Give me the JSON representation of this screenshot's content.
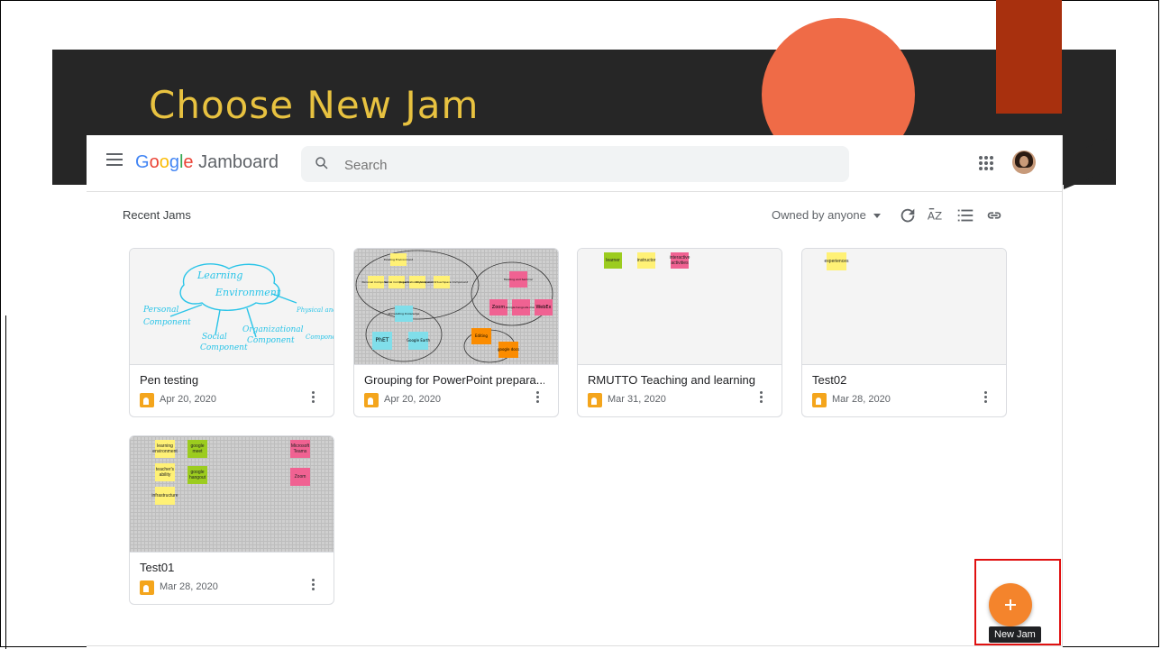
{
  "slide": {
    "title": "Choose New Jam",
    "colors": {
      "band": "#262626",
      "title": "#e8c240",
      "circle": "#ef6b47",
      "accent_rect": "#a8300e"
    }
  },
  "app": {
    "brand_google": "Google",
    "brand_product": "Jamboard",
    "search_placeholder": "Search",
    "menu_icon": "hamburger-menu-icon",
    "apps_icon": "google-apps-grid-icon",
    "account_icon": "account-avatar"
  },
  "main": {
    "section_title": "Recent Jams",
    "filter_label": "Owned by anyone",
    "toolbar_icons": [
      "refresh-icon",
      "sort-az-icon",
      "list-view-icon",
      "link-icon"
    ]
  },
  "jams": [
    {
      "title": "Pen testing",
      "date": "Apr 20, 2020",
      "thumb": "handwriting"
    },
    {
      "title": "Grouping for PowerPoint prepara...",
      "date": "Apr 20, 2020",
      "thumb": "mindmap"
    },
    {
      "title": "RMUTTO Teaching and learning",
      "date": "Mar 31, 2020",
      "thumb": "notes-row"
    },
    {
      "title": "Test02",
      "date": "Mar 28, 2020",
      "thumb": "single-note"
    },
    {
      "title": "Test01",
      "date": "Mar 28, 2020",
      "thumb": "grid-notes"
    }
  ],
  "thumb_text": {
    "pen": [
      "Learning",
      "Environment",
      "Personal",
      "Component",
      "Social",
      "Component",
      "Organizational",
      "Component",
      "Physical and Virtual Space",
      "Component"
    ],
    "mindmap": [
      "Existing Environment",
      "Personal Component",
      "Social Component",
      "Organizational Component",
      "Physical and Virtual Space Component",
      "Meeting and Seminar",
      "Zoom",
      "Google hangouts meet",
      "WebEx",
      "Stimulating Knowledge",
      "PhET",
      "Google Earth",
      "Editing",
      "google docs"
    ],
    "rmutto": [
      "learner",
      "instructor",
      "interactive activities"
    ],
    "test02": [
      "experiences"
    ],
    "test01": [
      "learning environment",
      "google meet",
      "Microsoft Teams",
      "teacher's ability",
      "google hangout",
      "Zoom",
      "infrastructure"
    ]
  },
  "fab": {
    "label": "+",
    "tooltip": "New Jam",
    "color": "#f4842c"
  }
}
